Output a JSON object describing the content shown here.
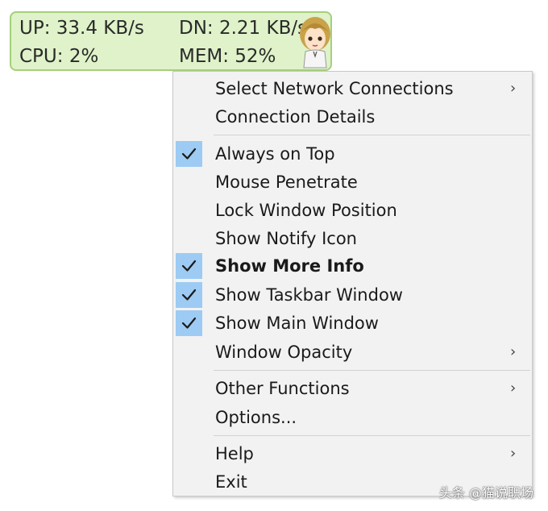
{
  "widget": {
    "up_text": "UP: 33.4 KB/s",
    "dn_text": "DN: 2.21 KB/s",
    "cpu_text": "CPU: 2%",
    "mem_text": "MEM: 52%",
    "mascot_icon": "anime-girl-mascot-icon"
  },
  "menu": {
    "items": [
      {
        "label": "Select Network Connections",
        "checked": false,
        "submenu": true
      },
      {
        "label": "Connection Details",
        "checked": false,
        "submenu": false
      },
      {
        "label": "Always on Top",
        "checked": true,
        "submenu": false
      },
      {
        "label": "Mouse Penetrate",
        "checked": false,
        "submenu": false
      },
      {
        "label": "Lock Window Position",
        "checked": false,
        "submenu": false
      },
      {
        "label": "Show Notify Icon",
        "checked": false,
        "submenu": false
      },
      {
        "label": "Show More Info",
        "checked": true,
        "submenu": false,
        "bold": true
      },
      {
        "label": "Show Taskbar Window",
        "checked": true,
        "submenu": false
      },
      {
        "label": "Show Main Window",
        "checked": true,
        "submenu": false
      },
      {
        "label": "Window Opacity",
        "checked": false,
        "submenu": true
      },
      {
        "label": "Other Functions",
        "checked": false,
        "submenu": true
      },
      {
        "label": "Options...",
        "checked": false,
        "submenu": false
      },
      {
        "label": "Help",
        "checked": false,
        "submenu": true
      },
      {
        "label": "Exit",
        "checked": false,
        "submenu": false
      }
    ],
    "checkmark_glyph": "✓",
    "arrow_glyph": "›"
  },
  "colors": {
    "widget_bg": "#dff2c9",
    "widget_border": "#a6cf7c",
    "check_bg": "#9dcbf3",
    "menu_bg": "#f2f2f2"
  },
  "watermark": "头条 @猫说职场"
}
